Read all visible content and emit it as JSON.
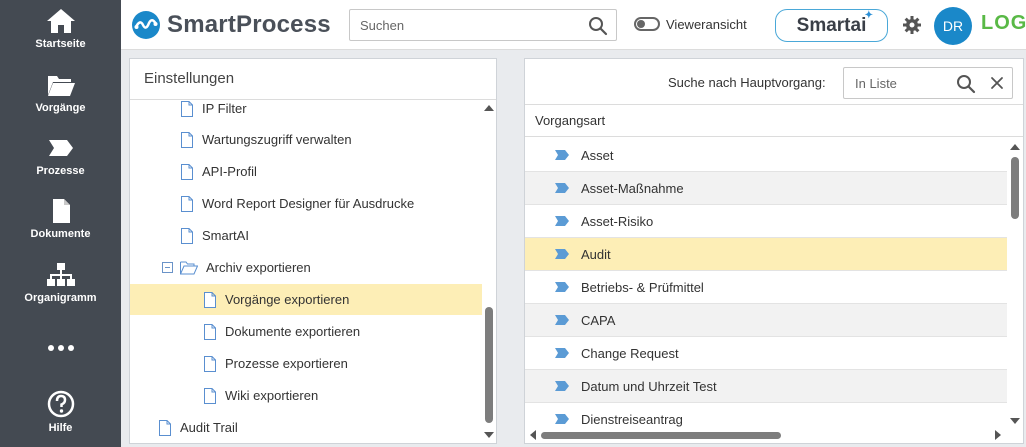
{
  "app": {
    "logo_text": "SmartProcess",
    "brand_tail": "LOG",
    "colors": {
      "sidebar": "#444a52",
      "accent": "#1a88c9",
      "selected_row": "#fdeeb6",
      "brand_green": "#59b946"
    }
  },
  "sidebar": {
    "items": [
      {
        "label": "Startseite",
        "icon": "home-icon"
      },
      {
        "label": "Vorgänge",
        "icon": "folder-open-icon"
      },
      {
        "label": "Prozesse",
        "icon": "process-chevron-icon"
      },
      {
        "label": "Dokumente",
        "icon": "document-icon"
      },
      {
        "label": "Organigramm",
        "icon": "org-chart-icon"
      },
      {
        "label": "",
        "icon": "more-dots-icon"
      },
      {
        "label": "Hilfe",
        "icon": "help-icon"
      }
    ]
  },
  "header": {
    "search_placeholder": "Suchen",
    "viewer_toggle_label": "Vieweransicht",
    "smartai_label": "Smartai",
    "avatar_initials": "DR"
  },
  "settings_panel": {
    "title": "Einstellungen",
    "tree": [
      {
        "label": "IP Filter",
        "level": 1,
        "type": "doc"
      },
      {
        "label": "Wartungszugriff verwalten",
        "level": 1,
        "type": "doc"
      },
      {
        "label": "API-Profil",
        "level": 1,
        "type": "doc"
      },
      {
        "label": "Word Report Designer für Ausdrucke",
        "level": 1,
        "type": "doc"
      },
      {
        "label": "SmartAI",
        "level": 1,
        "type": "doc"
      },
      {
        "label": "Archiv exportieren",
        "level": 1,
        "type": "folder",
        "expanded": true
      },
      {
        "label": "Vorgänge exportieren",
        "level": 2,
        "type": "doc",
        "selected": true
      },
      {
        "label": "Dokumente exportieren",
        "level": 2,
        "type": "doc"
      },
      {
        "label": "Prozesse exportieren",
        "level": 2,
        "type": "doc"
      },
      {
        "label": "Wiki exportieren",
        "level": 2,
        "type": "doc"
      },
      {
        "label": "Audit Trail",
        "level": 0,
        "type": "doc"
      }
    ]
  },
  "process_panel": {
    "filter_label": "Suche nach Hauptvorgang:",
    "filter_placeholder": "In Liste",
    "column_header": "Vorgangsart",
    "rows": [
      {
        "label": "Asset"
      },
      {
        "label": "Asset-Maßnahme"
      },
      {
        "label": "Asset-Risiko"
      },
      {
        "label": "Audit",
        "selected": true
      },
      {
        "label": "Betriebs- & Prüfmittel"
      },
      {
        "label": "CAPA"
      },
      {
        "label": "Change Request"
      },
      {
        "label": "Datum und Uhrzeit Test"
      },
      {
        "label": "Dienstreiseantrag"
      }
    ]
  }
}
